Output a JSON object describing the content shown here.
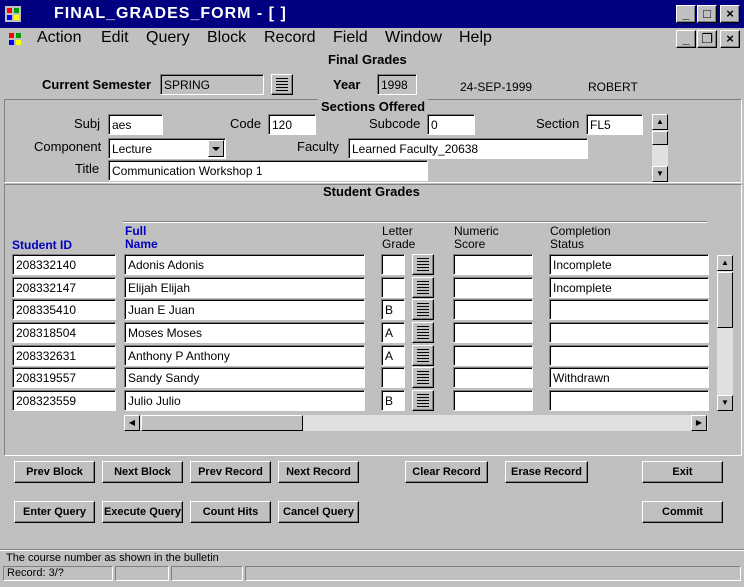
{
  "window": {
    "title": "FINAL_GRADES_FORM - [ ]",
    "controls": {
      "minimize": "_",
      "maximize": "□",
      "close": "×",
      "mdi_minimize": "_",
      "mdi_restore": "❐",
      "mdi_close": "×"
    }
  },
  "menu": [
    "Action",
    "Edit",
    "Query",
    "Block",
    "Record",
    "Field",
    "Window",
    "Help"
  ],
  "header": {
    "form_title": "Final Grades",
    "semester_label": "Current Semester",
    "semester_value": "SPRING",
    "year_label": "Year",
    "year_value": "1998",
    "date": "24-SEP-1999",
    "user": "ROBERT"
  },
  "sections": {
    "title": "Sections Offered",
    "subj_label": "Subj",
    "subj_value": "aes",
    "code_label": "Code",
    "code_value": "120",
    "subcode_label": "Subcode",
    "subcode_value": "0",
    "section_label": "Section",
    "section_value": "FL5",
    "component_label": "Component",
    "component_value": "Lecture",
    "faculty_label": "Faculty",
    "faculty_value": "Learned  Faculty_20638",
    "title_label": "Title",
    "title_value": "Communication Workshop 1"
  },
  "grades": {
    "title": "Student Grades",
    "col_student_id": "Student ID",
    "col_full_name": "Full\nName",
    "col_letter_grade": "Letter\nGrade",
    "col_numeric_score": "Numeric\nScore",
    "col_completion_status": "Completion\nStatus",
    "rows": [
      {
        "id": "208332140",
        "name": "Adonis  Adonis",
        "grade": "",
        "score": "",
        "status": "Incomplete"
      },
      {
        "id": "208332147",
        "name": "Elijah  Elijah",
        "grade": "",
        "score": "",
        "status": "Incomplete"
      },
      {
        "id": "208335410",
        "name": "Juan E Juan",
        "grade": "B",
        "score": "",
        "status": ""
      },
      {
        "id": "208318504",
        "name": "Moses  Moses",
        "grade": "A",
        "score": "",
        "status": ""
      },
      {
        "id": "208332631",
        "name": "Anthony P Anthony",
        "grade": "A",
        "score": "",
        "status": ""
      },
      {
        "id": "208319557",
        "name": "Sandy  Sandy",
        "grade": "",
        "score": "",
        "status": "Withdrawn"
      },
      {
        "id": "208323559",
        "name": "Julio  Julio",
        "grade": "B",
        "score": "",
        "status": ""
      }
    ]
  },
  "buttons": {
    "prev_block": "Prev Block",
    "next_block": "Next Block",
    "prev_record": "Prev Record",
    "next_record": "Next Record",
    "clear_record": "Clear Record",
    "erase_record": "Erase Record",
    "exit": "Exit",
    "enter_query": "Enter Query",
    "execute_query": "Execute Query",
    "count_hits": "Count Hits",
    "cancel_query": "Cancel Query",
    "commit": "Commit"
  },
  "status": {
    "hint": "The course number as shown in the bulletin",
    "record": "Record: 3/?"
  },
  "colors": {
    "titlebar": "#000080",
    "face": "#c0c0c0",
    "blue_label": "#0000c0"
  },
  "icons": [
    "app-icon",
    "menu-app-icon",
    "list-of-values-icon",
    "dropdown-arrow-icon",
    "scroll-up-icon",
    "scroll-down-icon",
    "scroll-left-icon",
    "scroll-right-icon"
  ]
}
